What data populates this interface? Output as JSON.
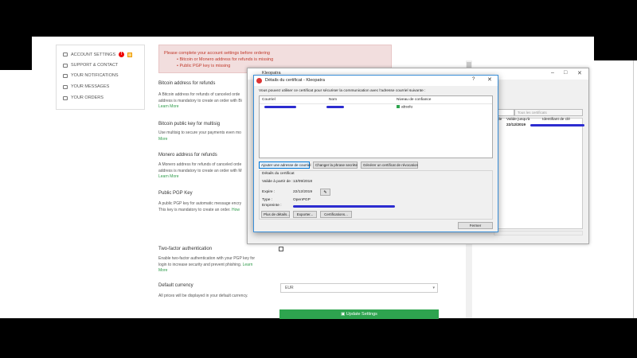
{
  "sidebar": {
    "items": [
      {
        "label": "ACCOUNT SETTINGS",
        "badge": "!"
      },
      {
        "label": "SUPPORT & CONTACT"
      },
      {
        "label": "YOUR NOTIFICATIONS"
      },
      {
        "label": "YOUR MESSAGES"
      },
      {
        "label": "YOUR ORDERS"
      }
    ]
  },
  "alert": {
    "heading": "Please complete your account settings before ordering",
    "items": [
      "Bitcoin or Monero address for refunds is missing",
      "Public PGP key is missing"
    ]
  },
  "sections": {
    "btc_refund": {
      "title": "Bitcoin address for refunds",
      "line1": "A Bitcoin address for refunds of canceled orde",
      "line2": "address is mandatory to create an order with Bi",
      "link": "Learn More"
    },
    "btc_multisig": {
      "title": "Bitcoin public key for multisig",
      "line1": "Use multisig to secure your payments even mo",
      "link": "More"
    },
    "xmr_refund": {
      "title": "Monero address for refunds",
      "line1": "A Monero address for refunds of canceled orde",
      "line2": "address is mandatory to create an order with M",
      "link": "Learn More"
    },
    "pgp": {
      "title": "Public PGP Key",
      "line1": "A public PGP key for automatic message encry",
      "line2": "This key is mandatory to create an order.",
      "link": "How"
    },
    "twofa": {
      "title": "Two-factor authentication",
      "line1": "Enable two-factor authentication with your PGP key for",
      "line2": "login to increase security and prevent phishing.",
      "link1": "Learn",
      "link2": "More"
    },
    "currency": {
      "title": "Default currency",
      "desc": "All prices will be displayed in your default currency.",
      "value": "EUR"
    }
  },
  "update_button": "Update Settings",
  "kleopatra": {
    "title": "Kleopatra",
    "search_placeholder": "Tous les certificats",
    "columns": [
      "de",
      "Valide jusqu'à",
      "Identifiant de clé"
    ],
    "row": {
      "valid_until": "22/12/2019"
    }
  },
  "dialog": {
    "title": "Détails du certificat - Kleopatra",
    "help": "?",
    "instruction": "Vous pouvez utiliser ce certificat pour sécuriser la communication avec l'adresse courriel suivante :",
    "columns": [
      "Courriel",
      "Nom",
      "Niveau de confiance"
    ],
    "trust": "absolu",
    "buttons": {
      "add_email": "Ajouter une adresse de courriel",
      "change_pass": "Changer la phrase secrète",
      "revocation": "Générer un certificat de révocation",
      "more_details": "Plus de détails...",
      "export": "Exporter...",
      "certifications": "Certifications...",
      "close": "Fermer"
    },
    "details": {
      "group_title": "Détails du certificat",
      "valid_from_label": "Valide à partir de :",
      "valid_from": "13/09/2018",
      "expires_label": "Expire :",
      "expires": "22/12/2019",
      "type_label": "Type :",
      "type": "OpenPGP",
      "fingerprint_label": "Empreinte :"
    }
  },
  "colors": {
    "accent_green": "#2ea44f",
    "alert_red": "#c0392b",
    "redaction_blue": "#2c2cd0"
  }
}
